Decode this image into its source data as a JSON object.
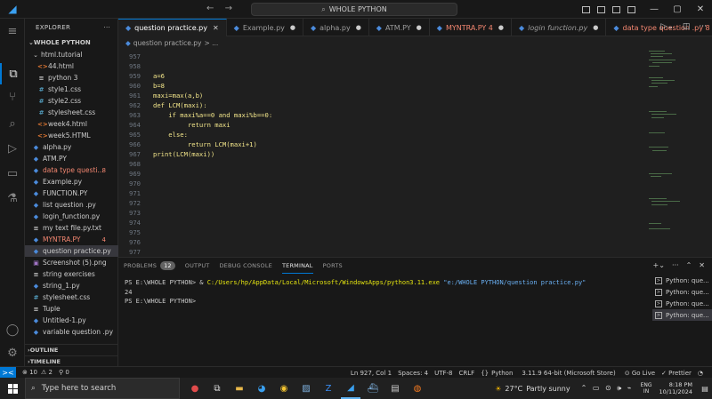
{
  "titlebar": {
    "search": "WHOLE PYTHON",
    "back": "←",
    "forward": "→"
  },
  "explorer": {
    "header": "EXPLORER",
    "more": "···",
    "folder": "WHOLE PYTHON",
    "subfolder": "html.tutorial",
    "items": [
      {
        "label": "44.html",
        "icon": "<>",
        "color": "#e37933",
        "indent": 2
      },
      {
        "label": "python 3",
        "icon": "≡",
        "color": "#cccccc",
        "indent": 2
      },
      {
        "label": "style1.css",
        "icon": "#",
        "color": "#519aba",
        "indent": 2
      },
      {
        "label": "style2.css",
        "icon": "#",
        "color": "#519aba",
        "indent": 2
      },
      {
        "label": "stylesheet.css",
        "icon": "#",
        "color": "#519aba",
        "indent": 2
      },
      {
        "label": "week4.html",
        "icon": "<>",
        "color": "#e37933",
        "indent": 2
      },
      {
        "label": "week5.HTML",
        "icon": "<>",
        "color": "#e37933",
        "indent": 2
      },
      {
        "label": "alpha.py",
        "icon": "◆",
        "color": "#4b8bdc",
        "indent": 1
      },
      {
        "label": "ATM.PY",
        "icon": "◆",
        "color": "#4b8bdc",
        "indent": 1
      },
      {
        "label": "data type questi...",
        "icon": "◆",
        "color": "#4b8bdc",
        "indent": 1,
        "badge": "8",
        "error": true
      },
      {
        "label": "Example.py",
        "icon": "◆",
        "color": "#4b8bdc",
        "indent": 1
      },
      {
        "label": "FUNCTION.PY",
        "icon": "◆",
        "color": "#4b8bdc",
        "indent": 1
      },
      {
        "label": "list question .py",
        "icon": "◆",
        "color": "#4b8bdc",
        "indent": 1
      },
      {
        "label": "login_function.py",
        "icon": "◆",
        "color": "#4b8bdc",
        "indent": 1
      },
      {
        "label": "my text file.py.txt",
        "icon": "≡",
        "color": "#cccccc",
        "indent": 1
      },
      {
        "label": "MYNTRA.PY",
        "icon": "◆",
        "color": "#4b8bdc",
        "indent": 1,
        "badge": "4",
        "error": true
      },
      {
        "label": "question practice.py",
        "icon": "◆",
        "color": "#4b8bdc",
        "indent": 1,
        "selected": true
      },
      {
        "label": "Screenshot (5).png",
        "icon": "▣",
        "color": "#a074c4",
        "indent": 1
      },
      {
        "label": "string exercises",
        "icon": "≡",
        "color": "#cccccc",
        "indent": 1
      },
      {
        "label": "string_1.py",
        "icon": "◆",
        "color": "#4b8bdc",
        "indent": 1
      },
      {
        "label": "stylesheet.css",
        "icon": "#",
        "color": "#519aba",
        "indent": 1
      },
      {
        "label": "Tuple",
        "icon": "≡",
        "color": "#cccccc",
        "indent": 1
      },
      {
        "label": "Untitled-1.py",
        "icon": "◆",
        "color": "#4b8bdc",
        "indent": 1
      },
      {
        "label": "variable question .py",
        "icon": "◆",
        "color": "#4b8bdc",
        "indent": 1
      }
    ],
    "outline": "OUTLINE",
    "timeline": "TIMELINE"
  },
  "tabs": [
    {
      "label": "question practice.py",
      "active": true,
      "close": "✕"
    },
    {
      "label": "Example.py",
      "dot": "●"
    },
    {
      "label": "alpha.py",
      "dot": "●"
    },
    {
      "label": "ATM.PY",
      "dot": "●"
    },
    {
      "label": "MYNTRA.PY 4",
      "dot": "●",
      "error": true
    },
    {
      "label": "login function.py",
      "dot": "●",
      "italic": true
    },
    {
      "label": "data type question .py 8",
      "dot": "●",
      "error": true
    }
  ],
  "breadcrumb": {
    "file": "question practice.py",
    "rest": "> ..."
  },
  "editor": {
    "lines": [
      {
        "n": "957",
        "code": ""
      },
      {
        "n": "958",
        "code": ""
      },
      {
        "n": "959",
        "code": "a=6"
      },
      {
        "n": "960",
        "code": "b=8"
      },
      {
        "n": "961",
        "code": "maxi=max(a,b)"
      },
      {
        "n": "962",
        "code": "def LCM(maxi):"
      },
      {
        "n": "963",
        "code": "    if maxi%a==0 and maxi%b==0:"
      },
      {
        "n": "964",
        "code": "         return maxi"
      },
      {
        "n": "965",
        "code": "    else:"
      },
      {
        "n": "966",
        "code": "         return LCM(maxi+1)"
      },
      {
        "n": "967",
        "code": "print(LCM(maxi))"
      },
      {
        "n": "968",
        "code": ""
      },
      {
        "n": "969",
        "code": ""
      },
      {
        "n": "970",
        "code": ""
      },
      {
        "n": "971",
        "code": ""
      },
      {
        "n": "972",
        "code": ""
      },
      {
        "n": "973",
        "code": ""
      },
      {
        "n": "974",
        "code": ""
      },
      {
        "n": "975",
        "code": ""
      },
      {
        "n": "976",
        "code": ""
      },
      {
        "n": "977",
        "code": ""
      }
    ]
  },
  "panel": {
    "tabs": {
      "problems": "PROBLEMS",
      "problems_count": "12",
      "output": "OUTPUT",
      "debug": "DEBUG CONSOLE",
      "terminal": "TERMINAL",
      "ports": "PORTS"
    },
    "terminal": {
      "prompt1": "PS E:\\WHOLE PYTHON> & ",
      "exe": "C:/Users/hp/AppData/Local/Microsoft/WindowsApps/python3.11.exe",
      "arg": " \"e:/WHOLE PYTHON/question practice.py\"",
      "output": "24",
      "prompt2": "PS E:\\WHOLE PYTHON> "
    },
    "instances": [
      "Python: que...",
      "Python: que...",
      "Python: que...",
      "Python: que..."
    ]
  },
  "statusbar": {
    "remote": "><",
    "errors": "⊗ 10",
    "warnings": "⚠ 2",
    "ports": "⚲ 0",
    "position": "Ln 927, Col 1",
    "spaces": "Spaces: 4",
    "encoding": "UTF-8",
    "eol": "CRLF",
    "braces": "{}",
    "language": "Python",
    "interpreter": "3.11.9 64-bit (Microsoft Store)",
    "golive": "Go Live",
    "prettier": "Prettier",
    "bell": "🔔"
  },
  "taskbar": {
    "search": "Type here to search",
    "weather_temp": "27°C",
    "weather_text": "Partly sunny",
    "lang_top": "ENG",
    "lang_bottom": "IN",
    "time": "8:18 PM",
    "date": "10/11/2024"
  }
}
